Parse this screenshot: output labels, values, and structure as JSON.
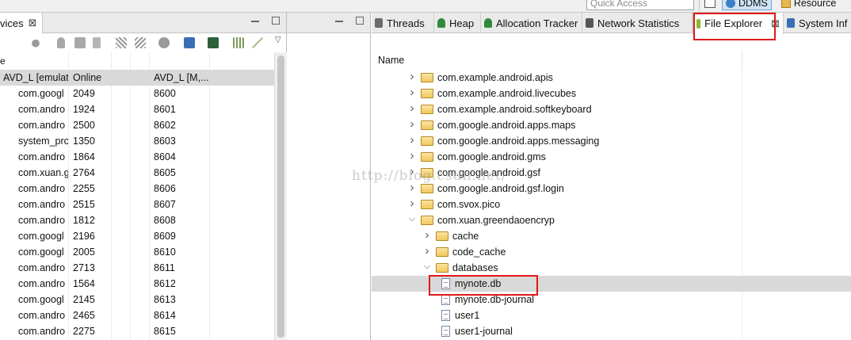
{
  "topbar": {
    "quick_access_placeholder": "Quick Access",
    "perspectives": [
      {
        "label": "DDMS",
        "active": true
      },
      {
        "label": "Resource",
        "active": false
      }
    ]
  },
  "devices": {
    "tab_label": "vices",
    "close_glyph": "⊠",
    "header_fragment": "e",
    "rows": [
      {
        "name": "AVD_L [emulat",
        "pid": "Online",
        "port": "AVD_L [M,...",
        "device": true,
        "selected": true
      },
      {
        "name": "com.googl",
        "pid": "2049",
        "port": "8600"
      },
      {
        "name": "com.andro",
        "pid": "1924",
        "port": "8601"
      },
      {
        "name": "com.andro",
        "pid": "2500",
        "port": "8602"
      },
      {
        "name": "system_prc",
        "pid": "1350",
        "port": "8603"
      },
      {
        "name": "com.andro",
        "pid": "1864",
        "port": "8604"
      },
      {
        "name": "com.xuan.g",
        "pid": "2764",
        "port": "8605"
      },
      {
        "name": "com.andro",
        "pid": "2255",
        "port": "8606"
      },
      {
        "name": "com.andro",
        "pid": "2515",
        "port": "8607"
      },
      {
        "name": "com.andro",
        "pid": "1812",
        "port": "8608"
      },
      {
        "name": "com.googl",
        "pid": "2196",
        "port": "8609"
      },
      {
        "name": "com.googl",
        "pid": "2005",
        "port": "8610"
      },
      {
        "name": "com.andro",
        "pid": "2713",
        "port": "8611"
      },
      {
        "name": "com.andro",
        "pid": "1564",
        "port": "8612"
      },
      {
        "name": "com.googl",
        "pid": "2145",
        "port": "8613"
      },
      {
        "name": "com.andro",
        "pid": "2465",
        "port": "8614"
      },
      {
        "name": "com.andro",
        "pid": "2275",
        "port": "8615"
      }
    ]
  },
  "right_tabs": [
    {
      "label": "Threads",
      "icon": "threads-icon"
    },
    {
      "label": "Heap",
      "icon": "heap-icon"
    },
    {
      "label": "Allocation Tracker",
      "icon": "allocation-icon"
    },
    {
      "label": "Network Statistics",
      "icon": "wifi-icon"
    },
    {
      "label": "File Explorer",
      "icon": "android-icon",
      "active": true
    },
    {
      "label": "System Inf",
      "icon": "system-info-icon"
    }
  ],
  "file_explorer": {
    "column_name": "Name",
    "items": [
      {
        "label": "com.example.android.apis",
        "type": "folder",
        "expanded": false,
        "level": 0
      },
      {
        "label": "com.example.android.livecubes",
        "type": "folder",
        "expanded": false,
        "level": 0
      },
      {
        "label": "com.example.android.softkeyboard",
        "type": "folder",
        "expanded": false,
        "level": 0
      },
      {
        "label": "com.google.android.apps.maps",
        "type": "folder",
        "expanded": false,
        "level": 0
      },
      {
        "label": "com.google.android.apps.messaging",
        "type": "folder",
        "expanded": false,
        "level": 0
      },
      {
        "label": "com.google.android.gms",
        "type": "folder",
        "expanded": false,
        "level": 0
      },
      {
        "label": "com.google.android.gsf",
        "type": "folder",
        "expanded": false,
        "level": 0
      },
      {
        "label": "com.google.android.gsf.login",
        "type": "folder",
        "expanded": false,
        "level": 0
      },
      {
        "label": "com.svox.pico",
        "type": "folder",
        "expanded": false,
        "level": 0
      },
      {
        "label": "com.xuan.greendaoencryp",
        "type": "folder",
        "expanded": true,
        "level": 0
      },
      {
        "label": "cache",
        "type": "folder",
        "expanded": false,
        "level": 1
      },
      {
        "label": "code_cache",
        "type": "folder",
        "expanded": false,
        "level": 1
      },
      {
        "label": "databases",
        "type": "folder",
        "expanded": true,
        "level": 1
      },
      {
        "label": "mynote.db",
        "type": "file",
        "level": 2,
        "selected": true
      },
      {
        "label": "mynote.db-journal",
        "type": "file",
        "level": 2
      },
      {
        "label": "user1",
        "type": "file",
        "level": 2
      },
      {
        "label": "user1-journal",
        "type": "file",
        "level": 2
      }
    ]
  },
  "watermark": "http://blog.csdn.net/",
  "colors": {
    "highlight_box": "#e01818",
    "selection": "#d9d9d9",
    "tab_bar": "#eaeaea"
  }
}
